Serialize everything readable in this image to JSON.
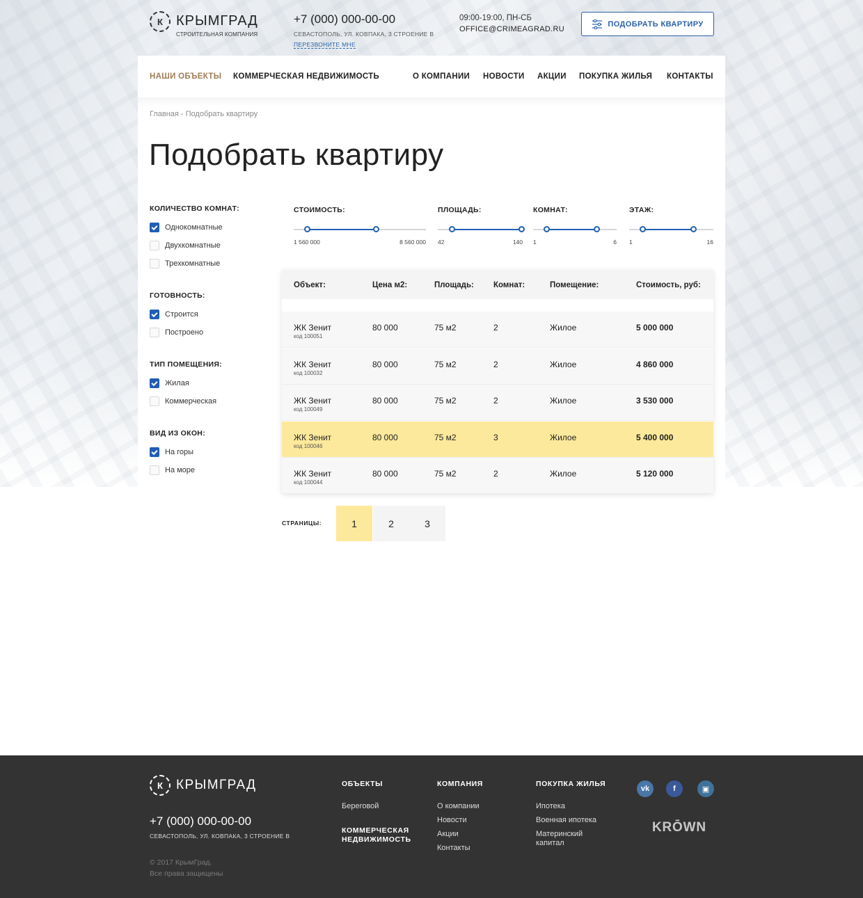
{
  "header": {
    "logo_name": "КРЫМГРАД",
    "logo_letter": "К",
    "logo_sub": "СТРОИТЕЛЬНАЯ КОМПАНИЯ",
    "phone": "+7 (000) 000-00-00",
    "address": "СЕВАСТОПОЛЬ, УЛ. КОВПАКА, 3 СТРОЕНИЕ В",
    "callback": "ПЕРЕЗВОНИТЕ МНЕ",
    "hours": "09:00-19:00, ПН-СБ",
    "email": "OFFICE@CRIMEAGRAD.RU",
    "pick_button": "ПОДОБРАТЬ КВАРТИРУ"
  },
  "nav": {
    "items": [
      {
        "label": "НАШИ ОБЪЕКТЫ",
        "active": true
      },
      {
        "label": "КОММЕРЧЕСКАЯ НЕДВИЖИМОСТЬ"
      },
      {
        "label": "О КОМПАНИИ"
      },
      {
        "label": "НОВОСТИ"
      },
      {
        "label": "АКЦИИ"
      },
      {
        "label": "ПОКУПКА ЖИЛЬЯ"
      },
      {
        "label": "КОНТАКТЫ"
      }
    ]
  },
  "breadcrumb": "Главная - Подобрать квартиру",
  "page_title": "Подобрать квартиру",
  "filters": [
    {
      "title": "КОЛИЧЕСТВО КОМНАТ:",
      "options": [
        {
          "label": "Однокомнатные",
          "checked": true
        },
        {
          "label": "Двухкомнатные",
          "checked": false
        },
        {
          "label": "Трехкомнатные",
          "checked": false
        }
      ]
    },
    {
      "title": "ГОТОВНОСТЬ:",
      "options": [
        {
          "label": "Строится",
          "checked": true
        },
        {
          "label": "Построено",
          "checked": false
        }
      ]
    },
    {
      "title": "ТИП ПОМЕЩЕНИЯ:",
      "options": [
        {
          "label": "Жилая",
          "checked": true
        },
        {
          "label": "Коммерческая",
          "checked": false
        }
      ]
    },
    {
      "title": "ВИД ИЗ ОКОН:",
      "options": [
        {
          "label": "На горы",
          "checked": true
        },
        {
          "label": "На море",
          "checked": false
        }
      ]
    }
  ],
  "sliders": [
    {
      "title": "СТОИМОСТЬ:",
      "min": "1 560 000",
      "max": "8 560 000",
      "from": 0.1,
      "to": 0.62
    },
    {
      "title": "ПЛОЩАДЬ:",
      "min": "42",
      "max": "140",
      "from": 0.16,
      "to": 0.98
    },
    {
      "title": "КОМНАТ:",
      "min": "1",
      "max": "6",
      "from": 0.16,
      "to": 0.76
    },
    {
      "title": "ЭТАЖ:",
      "min": "1",
      "max": "16",
      "from": 0.16,
      "to": 0.76
    }
  ],
  "table": {
    "headers": [
      "Объект:",
      "Цена м2:",
      "Площадь:",
      "Комнат:",
      "Помещение:",
      "Стоимость, руб:"
    ],
    "rows": [
      {
        "name": "ЖК Зенит",
        "code": "код 100051",
        "price_m2": "80 000",
        "area": "75 м2",
        "rooms": "2",
        "type": "Жилое",
        "price": "5 000 000",
        "highlight": false
      },
      {
        "name": "ЖК Зенит",
        "code": "код 100032",
        "price_m2": "80 000",
        "area": "75 м2",
        "rooms": "2",
        "type": "Жилое",
        "price": "4 860 000",
        "highlight": false
      },
      {
        "name": "ЖК Зенит",
        "code": "код 100049",
        "price_m2": "80 000",
        "area": "75 м2",
        "rooms": "2",
        "type": "Жилое",
        "price": "3 530 000",
        "highlight": false
      },
      {
        "name": "ЖК Зенит",
        "code": "код 100046",
        "price_m2": "80 000",
        "area": "75 м2",
        "rooms": "3",
        "type": "Жилое",
        "price": "5 400 000",
        "highlight": true
      },
      {
        "name": "ЖК Зенит",
        "code": "код 100044",
        "price_m2": "80 000",
        "area": "75 м2",
        "rooms": "2",
        "type": "Жилое",
        "price": "5 120 000",
        "highlight": false
      }
    ]
  },
  "pagination": {
    "label": "СТРАНИЦЫ:",
    "pages": [
      "1",
      "2",
      "3"
    ],
    "current": "1"
  },
  "footer": {
    "logo_name": "КРЫМГРАД",
    "logo_letter": "К",
    "phone": "+7 (000) 000-00-00",
    "address": "СЕВАСТОПОЛЬ, УЛ. КОВПАКА, 3 СТРОЕНИЕ В",
    "copyright_line1": "© 2017 КрымГрад.",
    "copyright_line2": "Все права защищены",
    "col_objects": {
      "title": "ОБЪЕКТЫ",
      "links": [
        "Береговой"
      ],
      "subtitle": "КОММЕРЧЕСКАЯ НЕДВИЖИМОСТЬ"
    },
    "col_company": {
      "title": "КОМПАНИЯ",
      "links": [
        "О компании",
        "Новости",
        "Акции",
        "Контакты"
      ]
    },
    "col_buy": {
      "title": "ПОКУПКА ЖИЛЬЯ",
      "links": [
        "Ипотека",
        "Военная ипотека",
        "Материнский капитал"
      ]
    },
    "social": [
      {
        "icon": "vk-icon",
        "glyph": "vk",
        "color": "#4a76a8"
      },
      {
        "icon": "facebook-icon",
        "glyph": "f",
        "color": "#3b5998"
      },
      {
        "icon": "instagram-icon",
        "glyph": "▣",
        "color": "#3f729b"
      }
    ],
    "developer": "KRŌWN"
  },
  "colors": {
    "accent_blue": "#1f5fb5",
    "active_nav": "#a07d55",
    "highlight_yellow": "#fde99b",
    "footer_bg": "#333333"
  }
}
